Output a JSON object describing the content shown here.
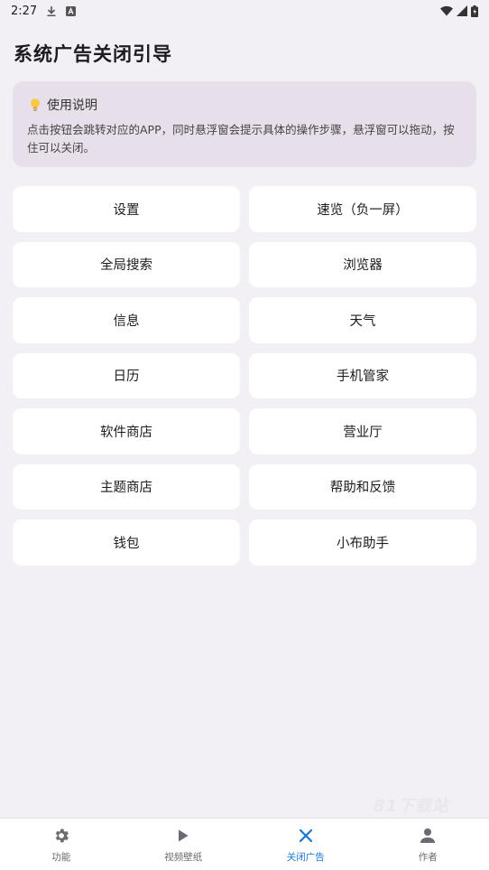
{
  "status_bar": {
    "time": "2:27",
    "icons": [
      "download-icon",
      "app-notification-icon",
      "wifi-icon",
      "signal-icon",
      "battery-icon"
    ]
  },
  "page": {
    "title": "系统广告关闭引导"
  },
  "info_card": {
    "icon": "lightbulb-icon",
    "heading": "使用说明",
    "body": "点击按钮会跳转对应的APP，同时悬浮窗会提示具体的操作步骤，悬浮窗可以拖动，按住可以关闭。"
  },
  "buttons": [
    {
      "label": "设置"
    },
    {
      "label": "速览（负一屏）"
    },
    {
      "label": "全局搜索"
    },
    {
      "label": "浏览器"
    },
    {
      "label": "信息"
    },
    {
      "label": "天气"
    },
    {
      "label": "日历"
    },
    {
      "label": "手机管家"
    },
    {
      "label": "软件商店"
    },
    {
      "label": "营业厅"
    },
    {
      "label": "主题商店"
    },
    {
      "label": "帮助和反馈"
    },
    {
      "label": "钱包"
    },
    {
      "label": "小布助手"
    }
  ],
  "watermark": "81下载站",
  "bottom_nav": {
    "active_color": "#1976d2",
    "items": [
      {
        "label": "功能",
        "icon": "gear-icon"
      },
      {
        "label": "视频壁纸",
        "icon": "play-icon"
      },
      {
        "label": "关闭广告",
        "icon": "close-icon",
        "active": true
      },
      {
        "label": "作者",
        "icon": "person-icon"
      }
    ]
  }
}
